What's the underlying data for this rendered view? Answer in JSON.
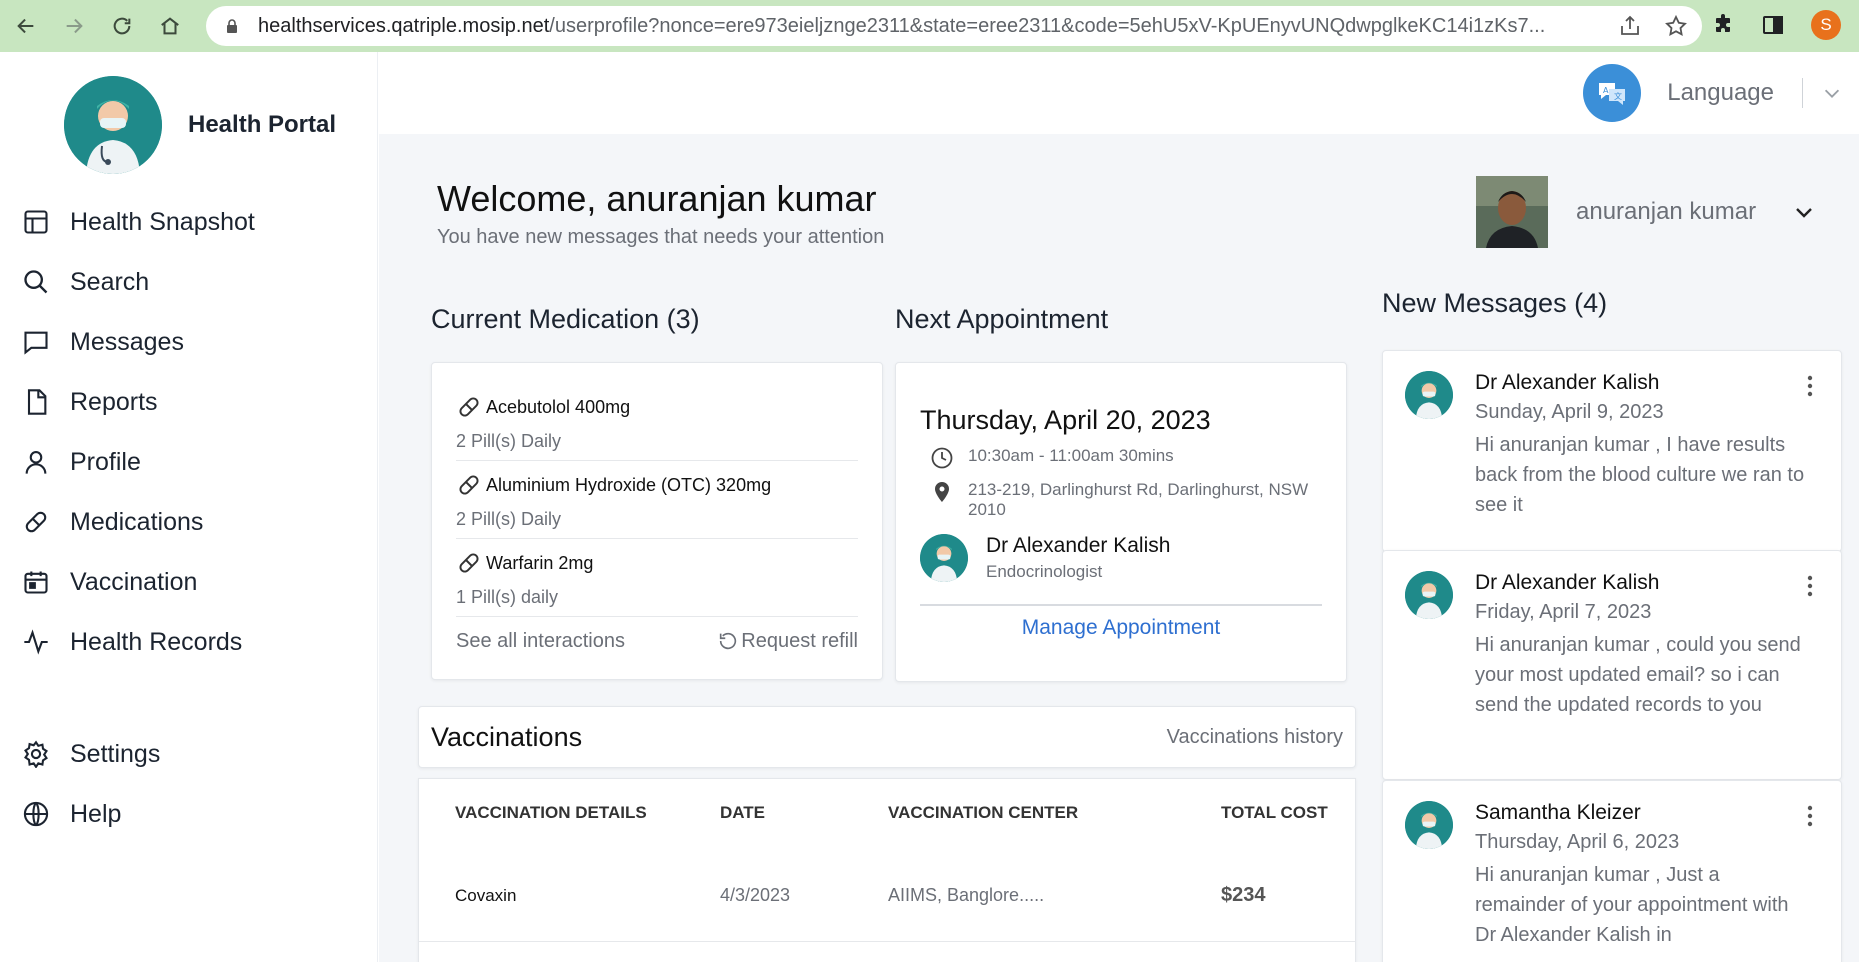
{
  "browser": {
    "url_host": "healthservices.qatriple.mosip.net",
    "url_path": "/userprofile?nonce=ere973eieljznge2311&state=eree2311&code=5ehU5xV-KpUEnyvUNQdwpglkeKC14i1zKs7...",
    "profile_initial": "S"
  },
  "brand": {
    "name": "Health Portal"
  },
  "nav": [
    {
      "label": "Health Snapshot",
      "icon": "grid-icon"
    },
    {
      "label": "Search",
      "icon": "search-icon"
    },
    {
      "label": "Messages",
      "icon": "chat-icon"
    },
    {
      "label": "Reports",
      "icon": "document-icon"
    },
    {
      "label": "Profile",
      "icon": "user-icon"
    },
    {
      "label": "Medications",
      "icon": "pill-icon"
    },
    {
      "label": "Vaccination",
      "icon": "calendar-icon"
    },
    {
      "label": "Health Records",
      "icon": "pulse-icon"
    }
  ],
  "nav_bottom": [
    {
      "label": "Settings",
      "icon": "gear-icon"
    },
    {
      "label": "Help",
      "icon": "globe-icon"
    }
  ],
  "topbar": {
    "language_label": "Language"
  },
  "welcome": {
    "title": "Welcome, anuranjan kumar",
    "subtitle": "You have new messages that needs your attention"
  },
  "user": {
    "name": "anuranjan kumar"
  },
  "medication": {
    "title": "Current Medication (3)",
    "items": [
      {
        "name": "Acebutolol 400mg",
        "dose": "2 Pill(s) Daily"
      },
      {
        "name": "Aluminium Hydroxide (OTC) 320mg",
        "dose": "2 Pill(s) Daily"
      },
      {
        "name": "Warfarin 2mg",
        "dose": "1 Pill(s) daily"
      }
    ],
    "see_all": "See all interactions",
    "refill": "Request refill"
  },
  "appointment": {
    "title": "Next Appointment",
    "date": "Thursday, April 20, 2023",
    "time": "10:30am - 11:00am 30mins",
    "address": "213-219, Darlinghurst Rd, Darlinghurst, NSW 2010",
    "doctor": "Dr Alexander Kalish",
    "specialty": "Endocrinologist",
    "manage": "Manage Appointment"
  },
  "vaccinations": {
    "title": "Vaccinations",
    "history_link": "Vaccinations history",
    "columns": [
      "VACCINATION DETAILS",
      "DATE",
      "VACCINATION CENTER",
      "TOTAL COST"
    ],
    "rows": [
      {
        "details": "Covaxin",
        "date": "4/3/2023",
        "center": "AIIMS, Banglore.....",
        "cost": "$234"
      }
    ]
  },
  "messages": {
    "title": "New Messages (4)",
    "items": [
      {
        "from": "Dr Alexander Kalish",
        "date": "Sunday, April 9, 2023",
        "text": "Hi anuranjan kumar , I have results back from the blood culture we ran to see it"
      },
      {
        "from": "Dr Alexander Kalish",
        "date": "Friday, April 7, 2023",
        "text": "Hi anuranjan kumar , could you send your most updated email? so i can send the updated records to you"
      },
      {
        "from": "Samantha Kleizer",
        "date": "Thursday, April 6, 2023",
        "text": "Hi anuranjan kumar , Just a remainder of your appointment with Dr Alexander Kalish in"
      }
    ]
  },
  "colors": {
    "accent_link": "#2e6fd0",
    "chrome": "#c8e6c0",
    "avatar": "#1f8a8a"
  }
}
